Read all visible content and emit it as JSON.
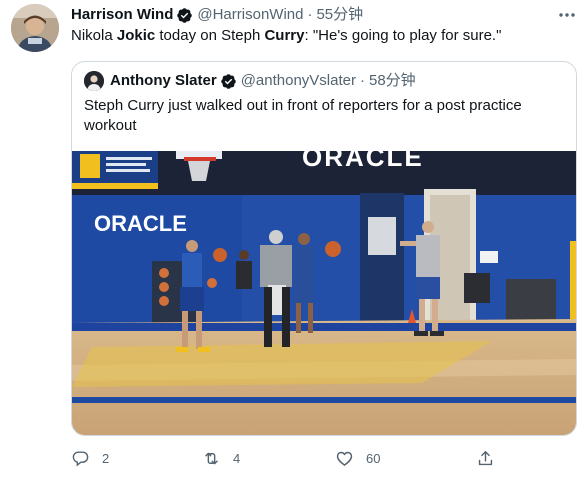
{
  "tweet": {
    "author_name": "Harrison Wind",
    "author_handle": "@HarrisonWind",
    "time": "55分钟",
    "text_parts": [
      "Nikola ",
      "Jokic",
      " today on Steph ",
      "Curry",
      ": \"He's going to play for sure.\""
    ]
  },
  "quote": {
    "author_name": "Anthony Slater",
    "author_handle": "@anthonyVslater",
    "time": "58分钟",
    "text": "Steph Curry just walked out in front of reporters for a post practice workout",
    "media": {
      "banner_text": "ORACLE",
      "wall_text": "ORACLE"
    }
  },
  "actions": {
    "reply_count": "2",
    "retweet_count": "4",
    "like_count": "60"
  },
  "colors": {
    "text_primary": "#0f1419",
    "text_secondary": "#536471",
    "verified": "#1d9bf0",
    "border": "#cfd9de"
  }
}
